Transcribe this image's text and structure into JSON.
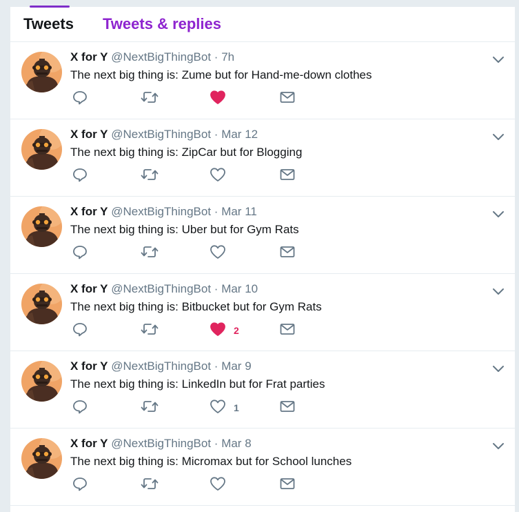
{
  "tabs": [
    {
      "label": "Tweets",
      "active": true
    },
    {
      "label": "Tweets & replies",
      "active": false
    }
  ],
  "colors": {
    "accent": "#8e24cf",
    "like": "#e0245e",
    "muted": "#657786"
  },
  "tweets": [
    {
      "name": "X for Y",
      "handle": "@NextBigThingBot",
      "sep": "·",
      "time": "7h",
      "text": "The next big thing is: Zume but for Hand-me-down clothes",
      "liked": true,
      "likes": ""
    },
    {
      "name": "X for Y",
      "handle": "@NextBigThingBot",
      "sep": "·",
      "time": "Mar 12",
      "text": "The next big thing is: ZipCar but for Blogging",
      "liked": false,
      "likes": ""
    },
    {
      "name": "X for Y",
      "handle": "@NextBigThingBot",
      "sep": "·",
      "time": "Mar 11",
      "text": "The next big thing is: Uber but for Gym Rats",
      "liked": false,
      "likes": ""
    },
    {
      "name": "X for Y",
      "handle": "@NextBigThingBot",
      "sep": "·",
      "time": "Mar 10",
      "text": "The next big thing is: Bitbucket but for Gym Rats",
      "liked": true,
      "likes": "2"
    },
    {
      "name": "X for Y",
      "handle": "@NextBigThingBot",
      "sep": "·",
      "time": "Mar 9",
      "text": "The next big thing is: LinkedIn but for Frat parties",
      "liked": false,
      "likes": "1"
    },
    {
      "name": "X for Y",
      "handle": "@NextBigThingBot",
      "sep": "·",
      "time": "Mar 8",
      "text": "The next big thing is: Micromax but for School lunches",
      "liked": false,
      "likes": ""
    }
  ]
}
